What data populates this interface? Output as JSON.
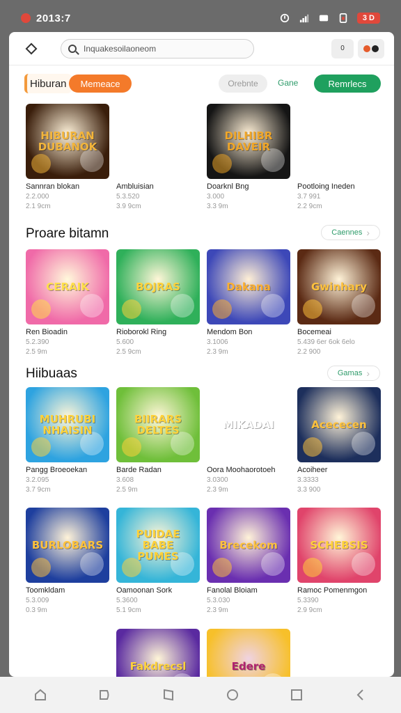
{
  "status": {
    "time": "2013:7",
    "battery": "3 D"
  },
  "search": {
    "query": "Inquakesoilaoneom"
  },
  "topbar": {
    "btn1": "0"
  },
  "chips": {
    "home": "Hiburan",
    "orange": "Memeace",
    "gray": "Orebnte",
    "link": "Gane",
    "green": "Remrlecs"
  },
  "sections": [
    {
      "title": "",
      "see_all": ""
    },
    {
      "title": "Proare bitamn",
      "see_all": "Caennes"
    },
    {
      "title": "Hiibuaas",
      "see_all": "Gamas"
    }
  ],
  "rows": [
    [
      {
        "name": "Sannran blokan",
        "m1": "2.2.000",
        "m2": "2.1 9cm",
        "thumb_text": "HIBURAN DUBANOK",
        "bg": "#3a1e0b",
        "fg": "#f3b53b"
      },
      {
        "name": "Ambluisian",
        "m1": "5.3.520",
        "m2": "3.9 9cm",
        "thumb_text": "",
        "bg": "#e9b54a",
        "fg": "#fff"
      },
      {
        "name": "Doarknl Bng",
        "m1": "3.000",
        "m2": "3.3 9m",
        "thumb_text": "DILHIBR DAVEIR",
        "bg": "#151515",
        "fg": "#f0a628"
      },
      {
        "name": "Pootloing Ineden",
        "m1": "3.7 991",
        "m2": "2.2 9cm",
        "thumb_text": "",
        "bg": "#f2c37a",
        "fg": "#fff"
      }
    ],
    [
      {
        "name": "Ren Bioadin",
        "m1": "5.2.390",
        "m2": "2.5 9m",
        "thumb_text": "CERAIK",
        "bg": "#f06aa8",
        "fg": "#ffe04a"
      },
      {
        "name": "Rioborokl Ring",
        "m1": "5.600",
        "m2": "2.5 9cm",
        "thumb_text": "BOJRAS",
        "bg": "#2fb05a",
        "fg": "#ffd23a"
      },
      {
        "name": "Mendom Bon",
        "m1": "3.1006",
        "m2": "2.3 9m",
        "thumb_text": "Dakana",
        "bg": "#3d48b8",
        "fg": "#ffb02e"
      },
      {
        "name": "Bocemeai",
        "m1": "5.439 6er 6ok 6elo",
        "m2": "2.2 900",
        "thumb_text": "Gwinhary",
        "bg": "#5b2a14",
        "fg": "#ffc23c"
      }
    ],
    [
      {
        "name": "Pangg Broeoekan",
        "m1": "3.2.095",
        "m2": "3.7 9cm",
        "thumb_text": "MUHRUBI NHAISIN",
        "bg": "#2ea3e0",
        "fg": "#ffd23a"
      },
      {
        "name": "Barde Radan",
        "m1": "3.608",
        "m2": "2.5 9m",
        "thumb_text": "BIIRARS DELTES",
        "bg": "#6fbf3a",
        "fg": "#ffd23a"
      },
      {
        "name": "Oora Moohaorotoeh",
        "m1": "3.0300",
        "m2": "2.3 9m",
        "thumb_text": "MIKADAI",
        "bg": "#f2a12c",
        "fg": "#fff"
      },
      {
        "name": "Acoiheer",
        "m1": "3.3333",
        "m2": "3.3 900",
        "thumb_text": "Acececen",
        "bg": "#1d2f5c",
        "fg": "#ffc23c"
      }
    ],
    [
      {
        "name": "Toomkldam",
        "m1": "5.3.009",
        "m2": "0.3 9m",
        "thumb_text": "BURLOBARS",
        "bg": "#1e3f9e",
        "fg": "#ffc23c"
      },
      {
        "name": "Oamoonan Sork",
        "m1": "5.3600",
        "m2": "5.1 9cm",
        "thumb_text": "PUIDAE BABE PUMES",
        "bg": "#35b5d8",
        "fg": "#ffd23a"
      },
      {
        "name": "Fanolal Bloiam",
        "m1": "5.3.030",
        "m2": "2.3 9m",
        "thumb_text": "Brecekom",
        "bg": "#6a2fb0",
        "fg": "#ffc23c"
      },
      {
        "name": "Ramoc Pomenmgon",
        "m1": "5.3390",
        "m2": "2.9 9cm",
        "thumb_text": "SCHEBSIS",
        "bg": "#e0446b",
        "fg": "#ffd23a"
      }
    ],
    [
      {
        "name": "",
        "m1": "",
        "m2": "",
        "thumb_text": "",
        "bg": "#4ab2e8",
        "fg": "#fff"
      },
      {
        "name": "",
        "m1": "",
        "m2": "",
        "thumb_text": "Fakdrecsl",
        "bg": "#5a2aa0",
        "fg": "#ffd23a"
      },
      {
        "name": "",
        "m1": "",
        "m2": "",
        "thumb_text": "Edere",
        "bg": "#f7c02a",
        "fg": "#b0226e"
      },
      {
        "name": "",
        "m1": "",
        "m2": "",
        "thumb_text": "",
        "bg": "#1f6a34",
        "fg": "#fff"
      }
    ]
  ]
}
